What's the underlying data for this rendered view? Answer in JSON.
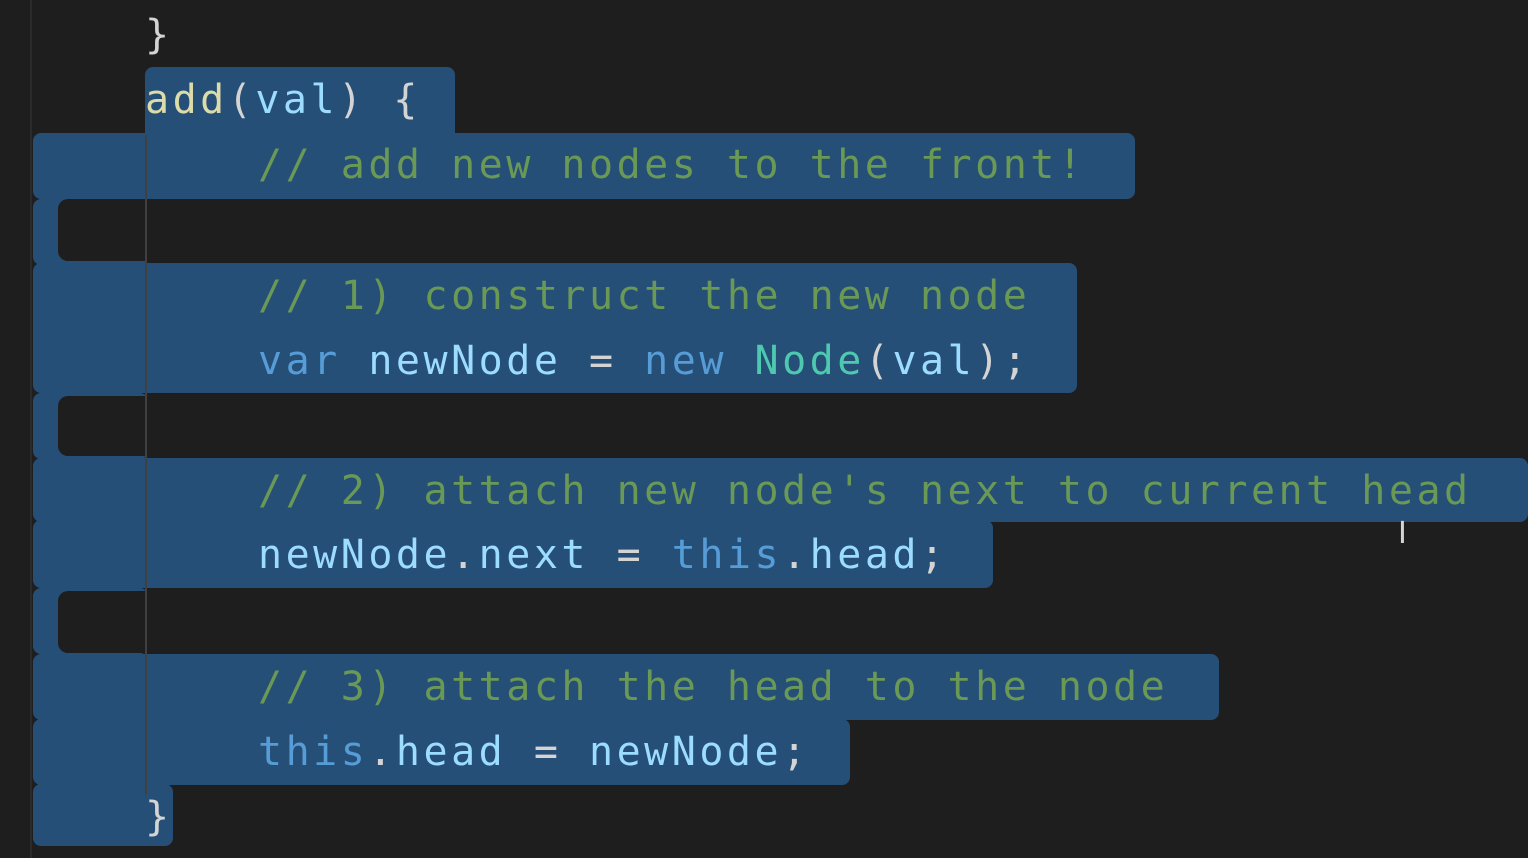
{
  "editor": {
    "lines": [
      {
        "tokens": [
          {
            "text": "}",
            "cls": "pun"
          }
        ]
      },
      {
        "tokens": [
          {
            "text": "add",
            "cls": "fn"
          },
          {
            "text": "(",
            "cls": "pun"
          },
          {
            "text": "val",
            "cls": "id"
          },
          {
            "text": ") {",
            "cls": "pun"
          }
        ]
      },
      {
        "tokens": [
          {
            "text": "// add new nodes to the front!",
            "cls": "cm"
          }
        ]
      },
      {
        "tokens": []
      },
      {
        "tokens": [
          {
            "text": "// 1) construct the new node",
            "cls": "cm"
          }
        ]
      },
      {
        "tokens": [
          {
            "text": "var",
            "cls": "kw"
          },
          {
            "text": " ",
            "cls": "pun"
          },
          {
            "text": "newNode",
            "cls": "id"
          },
          {
            "text": " = ",
            "cls": "pun"
          },
          {
            "text": "new",
            "cls": "kw"
          },
          {
            "text": " ",
            "cls": "pun"
          },
          {
            "text": "Node",
            "cls": "cls"
          },
          {
            "text": "(",
            "cls": "pun"
          },
          {
            "text": "val",
            "cls": "id"
          },
          {
            "text": ");",
            "cls": "pun"
          }
        ]
      },
      {
        "tokens": []
      },
      {
        "tokens": [
          {
            "text": "// 2) attach new node's next to current head",
            "cls": "cm"
          }
        ]
      },
      {
        "tokens": [
          {
            "text": "newNode",
            "cls": "id"
          },
          {
            "text": ".",
            "cls": "pun"
          },
          {
            "text": "next",
            "cls": "id"
          },
          {
            "text": " = ",
            "cls": "pun"
          },
          {
            "text": "this",
            "cls": "kw"
          },
          {
            "text": ".",
            "cls": "pun"
          },
          {
            "text": "head",
            "cls": "id"
          },
          {
            "text": ";",
            "cls": "pun"
          }
        ]
      },
      {
        "tokens": []
      },
      {
        "tokens": [
          {
            "text": "// 3) attach the head to the node",
            "cls": "cm"
          }
        ]
      },
      {
        "tokens": [
          {
            "text": "this",
            "cls": "kw"
          },
          {
            "text": ".",
            "cls": "pun"
          },
          {
            "text": "head",
            "cls": "id"
          },
          {
            "text": " = ",
            "cls": "pun"
          },
          {
            "text": "newNode",
            "cls": "id"
          },
          {
            "text": ";",
            "cls": "pun"
          }
        ]
      },
      {
        "tokens": [
          {
            "text": "}",
            "cls": "pun"
          }
        ]
      }
    ]
  },
  "colors": {
    "background": "#1e1e1e",
    "selection": "#264f78",
    "keyword": "#569cd6",
    "comment": "#6a9955",
    "identifier": "#9cdcfe",
    "function": "#dcdcaa",
    "class": "#4ec9b0",
    "punctuation": "#d4d4d4"
  },
  "cursor_icon": "text-cursor-icon"
}
